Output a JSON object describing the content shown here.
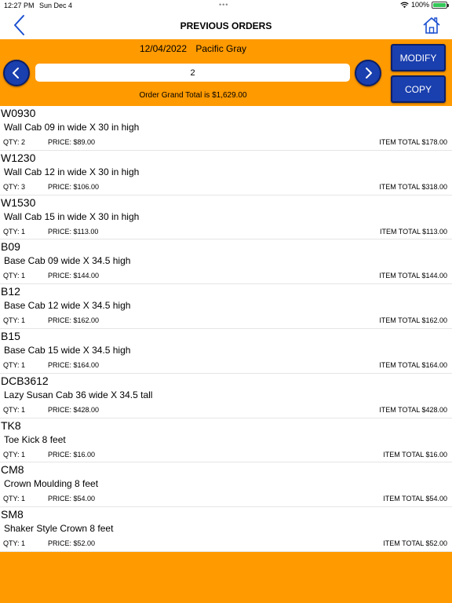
{
  "status_bar": {
    "time": "12:27 PM",
    "date": "Sun Dec 4",
    "battery": "100%"
  },
  "nav": {
    "title": "PREVIOUS ORDERS",
    "back_icon": "chevron-left-icon",
    "home_icon": "home-icon"
  },
  "order": {
    "date": "12/04/2022",
    "color": "Pacific Gray",
    "number": "2",
    "grand_total": "Order Grand Total is $1,629.00"
  },
  "buttons": {
    "modify": "MODIFY",
    "copy": "COPY"
  },
  "colors": {
    "accent": "#ff9a00",
    "button": "#1a3fae"
  },
  "items": [
    {
      "code": "W0930",
      "desc": "Wall Cab 09 in wide X 30 in high",
      "qty": "QTY: 2",
      "price": "PRICE: $89.00",
      "total": "ITEM TOTAL $178.00"
    },
    {
      "code": "W1230",
      "desc": "Wall Cab 12 in wide X 30 in high",
      "qty": "QTY: 3",
      "price": "PRICE: $106.00",
      "total": "ITEM TOTAL $318.00"
    },
    {
      "code": "W1530",
      "desc": "Wall Cab 15 in wide X 30 in high",
      "qty": "QTY: 1",
      "price": "PRICE: $113.00",
      "total": "ITEM TOTAL $113.00"
    },
    {
      "code": "B09",
      "desc": "Base Cab 09 wide X 34.5 high",
      "qty": "QTY: 1",
      "price": "PRICE: $144.00",
      "total": "ITEM TOTAL $144.00"
    },
    {
      "code": "B12",
      "desc": "Base Cab 12 wide X 34.5 high",
      "qty": "QTY: 1",
      "price": "PRICE: $162.00",
      "total": "ITEM TOTAL $162.00"
    },
    {
      "code": "B15",
      "desc": "Base Cab 15 wide X 34.5 high",
      "qty": "QTY: 1",
      "price": "PRICE: $164.00",
      "total": "ITEM TOTAL $164.00"
    },
    {
      "code": "DCB3612",
      "desc": "Lazy Susan Cab 36 wide X 34.5 tall",
      "qty": "QTY: 1",
      "price": "PRICE: $428.00",
      "total": "ITEM TOTAL $428.00"
    },
    {
      "code": "TK8",
      "desc": "Toe Kick 8 feet",
      "qty": "QTY: 1",
      "price": "PRICE: $16.00",
      "total": "ITEM TOTAL $16.00"
    },
    {
      "code": "CM8",
      "desc": "Crown Moulding 8 feet",
      "qty": "QTY: 1",
      "price": "PRICE: $54.00",
      "total": "ITEM TOTAL $54.00"
    },
    {
      "code": "SM8",
      "desc": "Shaker Style Crown 8 feet",
      "qty": "QTY: 1",
      "price": "PRICE: $52.00",
      "total": "ITEM TOTAL $52.00"
    }
  ]
}
